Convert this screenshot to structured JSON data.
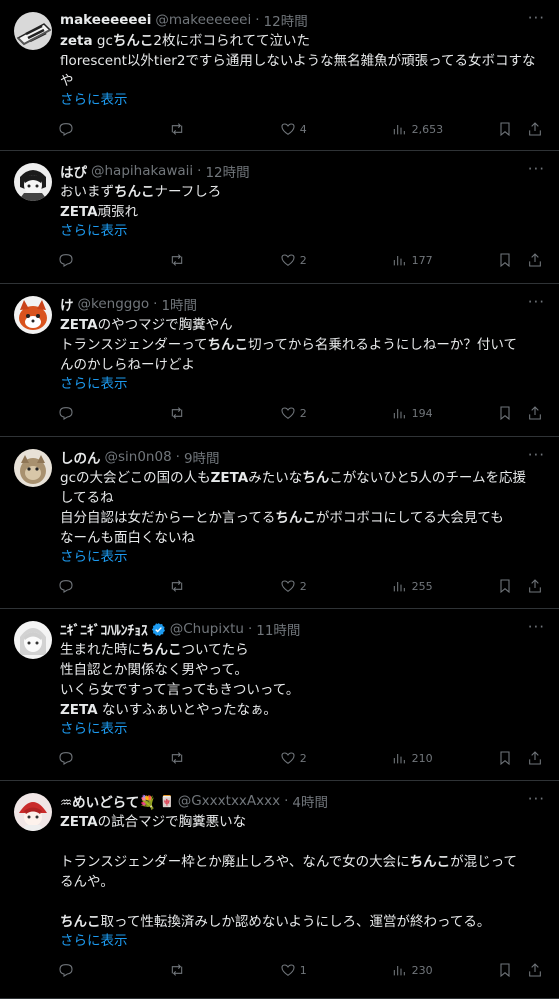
{
  "tweets": [
    {
      "name": "makeeeeeei",
      "handle": "@makeeeeeei",
      "time": "12時間",
      "lines": [
        [
          {
            "t": "zeta",
            "b": true
          },
          {
            "t": " gc"
          },
          {
            "t": "ちんこ",
            "b": true
          },
          {
            "t": "2枚にボコられてて泣いた"
          }
        ],
        [
          {
            "t": "florescent以外tier2ですら通用しないような無名雑魚が頑張ってる女ボコすな"
          }
        ],
        [
          {
            "t": "や"
          }
        ]
      ],
      "show_more": "さらに表示",
      "likes": "4",
      "views": "2,653"
    },
    {
      "name": "はぴ",
      "handle": "@hapihakawaii",
      "time": "12時間",
      "lines": [
        [
          {
            "t": "おいまず"
          },
          {
            "t": "ちんこ",
            "b": true
          },
          {
            "t": "ナーフしろ"
          }
        ],
        [
          {
            "t": "ZETA",
            "b": true
          },
          {
            "t": "頑張れ"
          }
        ]
      ],
      "show_more": "さらに表示",
      "likes": "2",
      "views": "177"
    },
    {
      "name": "け",
      "handle": "@kengggo",
      "time": "1時間",
      "lines": [
        [
          {
            "t": "ZETA",
            "b": true
          },
          {
            "t": "のやつマジで胸糞やん"
          }
        ],
        [
          {
            "t": "トランスジェンダーって"
          },
          {
            "t": "ちんこ",
            "b": true
          },
          {
            "t": "切ってから名乗れるようにしねーか？付いて"
          }
        ],
        [
          {
            "t": "んのかしらねーけどよ"
          }
        ]
      ],
      "show_more": "さらに表示",
      "likes": "2",
      "views": "194"
    },
    {
      "name": "しのん",
      "handle": "@sin0n08",
      "time": "9時間",
      "lines": [
        [
          {
            "t": "gcの大会どこの国の人も"
          },
          {
            "t": "ZETA",
            "b": true
          },
          {
            "t": "みたいな"
          },
          {
            "t": "ちん",
            "b": true
          },
          {
            "t": "こがないひと5人のチームを応援"
          }
        ],
        [
          {
            "t": "してるね"
          }
        ],
        [
          {
            "t": "自分自認は女だからーとか言ってる"
          },
          {
            "t": "ちんこ",
            "b": true
          },
          {
            "t": "がボコボコにしてる大会見ても"
          }
        ],
        [
          {
            "t": "なーんも面白くないね"
          }
        ]
      ],
      "show_more": "さらに表示",
      "likes": "2",
      "views": "255"
    },
    {
      "name": "ﾆｷﾞﾆｷﾞｺﾊﾙﾝﾁｮｽ",
      "handle": "@Chupixtu",
      "time": "11時間",
      "verified": true,
      "lines": [
        [
          {
            "t": "生まれた時に"
          },
          {
            "t": "ちんこ",
            "b": true
          },
          {
            "t": "ついてたら"
          }
        ],
        [
          {
            "t": "性自認とか関係なく男やって。"
          }
        ],
        [
          {
            "t": "いくら女ですって言ってもきついって。"
          }
        ],
        [
          {
            "t": "ZETA",
            "b": true
          },
          {
            "t": " ないすふぁいとやったなぁ。"
          }
        ]
      ],
      "show_more": "さらに表示",
      "likes": "2",
      "views": "210"
    },
    {
      "name": "♒めいどらて💐",
      "name_extra": "🀄",
      "handle": "@GxxxtxxAxxx",
      "time": "4時間",
      "lines": [
        [
          {
            "t": "ZETA",
            "b": true
          },
          {
            "t": "の試合マジで胸糞悪いな"
          }
        ],
        [
          {
            "t": ""
          }
        ],
        [
          {
            "t": "トランスジェンダー枠とか廃止しろや、なんで女の大会に"
          },
          {
            "t": "ちんこ",
            "b": true
          },
          {
            "t": "が混じって"
          }
        ],
        [
          {
            "t": "るんや。"
          }
        ],
        [
          {
            "t": ""
          }
        ],
        [
          {
            "t": "ちんこ",
            "b": true
          },
          {
            "t": "取って性転換済みしか認めないようにしろ、運営が終わってる。"
          }
        ]
      ],
      "show_more": "さらに表示",
      "likes": "1",
      "views": "230"
    }
  ],
  "dot": "·",
  "more": "···"
}
